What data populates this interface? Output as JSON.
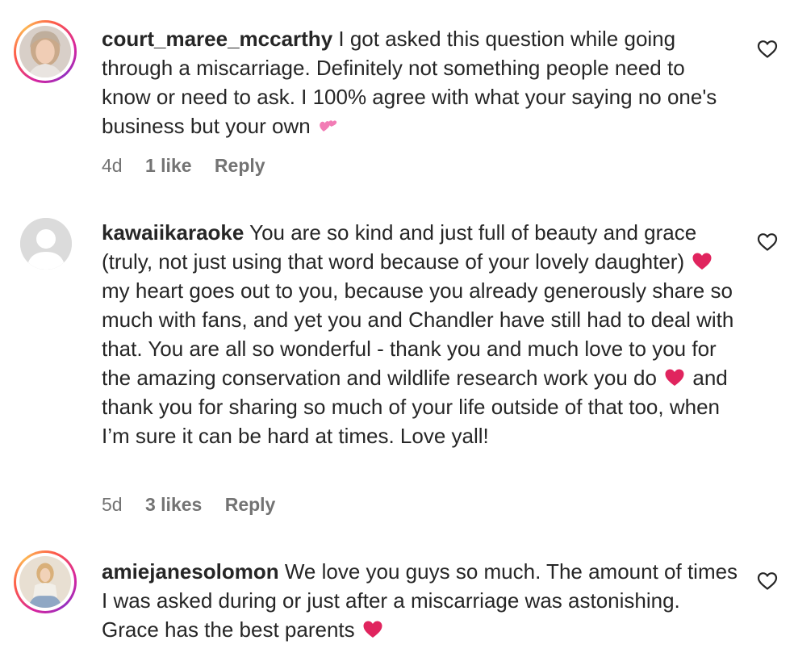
{
  "comments": [
    {
      "username": "court_maree_mccarthy",
      "text": "I got asked this question while going through a miscarriage. Definitely not something people need to know or need to ask. I 100% agree with what your saying no one's business but your own",
      "emoji_end": "💕",
      "time": "4d",
      "likes": "1 like",
      "reply": "Reply"
    },
    {
      "username": "kawaiikaraoke",
      "text_1": "You are so kind and just full of beauty and grace (truly, not just using that word because of your lovely daughter)",
      "emoji_1": "❤️",
      "text_2": "my heart goes out to you, because you already generously share so much with fans, and yet you and Chandler have still had to deal with that. You are all so wonderful - thank you and much love to you for the amazing conservation and wildlife research work you do",
      "emoji_2": "❤️",
      "text_3": "and thank you for sharing so much of your life outside of that too, when I’m sure it can be hard at times. Love yall!",
      "time": "5d",
      "likes": "3 likes",
      "reply": "Reply"
    },
    {
      "username": "amiejanesolomon",
      "text": "We love you guys so much. The amount of times I was asked during or just after a miscarriage was astonishing. Grace has the best parents",
      "emoji_end": "❤️"
    }
  ],
  "icons": {
    "like": "heart-outline-icon",
    "heart_emoji": "red-heart-emoji",
    "two_hearts_emoji": "two-hearts-emoji"
  },
  "colors": {
    "text": "#262626",
    "meta": "#737373",
    "heart_emoji": "#e0245e"
  }
}
